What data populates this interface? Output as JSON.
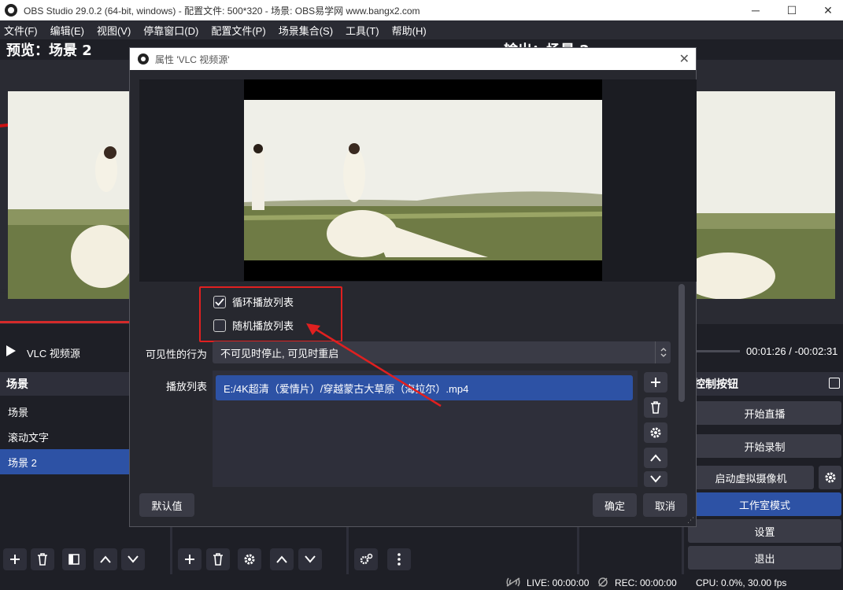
{
  "window": {
    "title": "OBS Studio 29.0.2 (64-bit, windows) - 配置文件: 500*320 - 场景: OBS易学网 www.bangx2.com",
    "minimize": "─",
    "maximize": "☐",
    "close": "✕"
  },
  "menu": [
    "文件(F)",
    "编辑(E)",
    "视图(V)",
    "停靠窗口(D)",
    "配置文件(P)",
    "场景集合(S)",
    "工具(T)",
    "帮助(H)"
  ],
  "preview": {
    "label": "预览：场景 2",
    "output_label": "输出：场景 2"
  },
  "player": {
    "source_name": "VLC 视频源",
    "time_current": "00:01:26",
    "time_sep": "/",
    "time_remaining": "-00:02:31"
  },
  "scenes": {
    "header": "场景",
    "items": [
      "场景",
      "滚动文字",
      "场景 2"
    ],
    "active_index": 2
  },
  "controls": {
    "header": "控制按钮",
    "start_stream": "开始直播",
    "start_record": "开始录制",
    "virtual_cam": "启动虚拟摄像机",
    "studio_mode": "工作室模式",
    "settings": "设置",
    "exit": "退出"
  },
  "status": {
    "live": "LIVE: 00:00:00",
    "rec": "REC: 00:00:00",
    "cpu": "CPU: 0.0%, 30.00 fps"
  },
  "dialog": {
    "title": "属性 'VLC 视频源'",
    "close": "✕",
    "loop_label": "循环播放列表",
    "loop_checked": true,
    "shuffle_label": "随机播放列表",
    "shuffle_checked": false,
    "visibility_label": "可见性的行为",
    "visibility_value": "不可见时停止, 可见时重启",
    "playlist_label": "播放列表",
    "playlist_items": [
      "E:/4K超清（爱情片）/穿越蒙古大草原（海拉尔）.mp4"
    ],
    "defaults_button": "默认值",
    "ok_button": "确定",
    "cancel_button": "取消"
  },
  "colors": {
    "accent": "#2d52a5",
    "highlight_outline": "#e02020"
  }
}
